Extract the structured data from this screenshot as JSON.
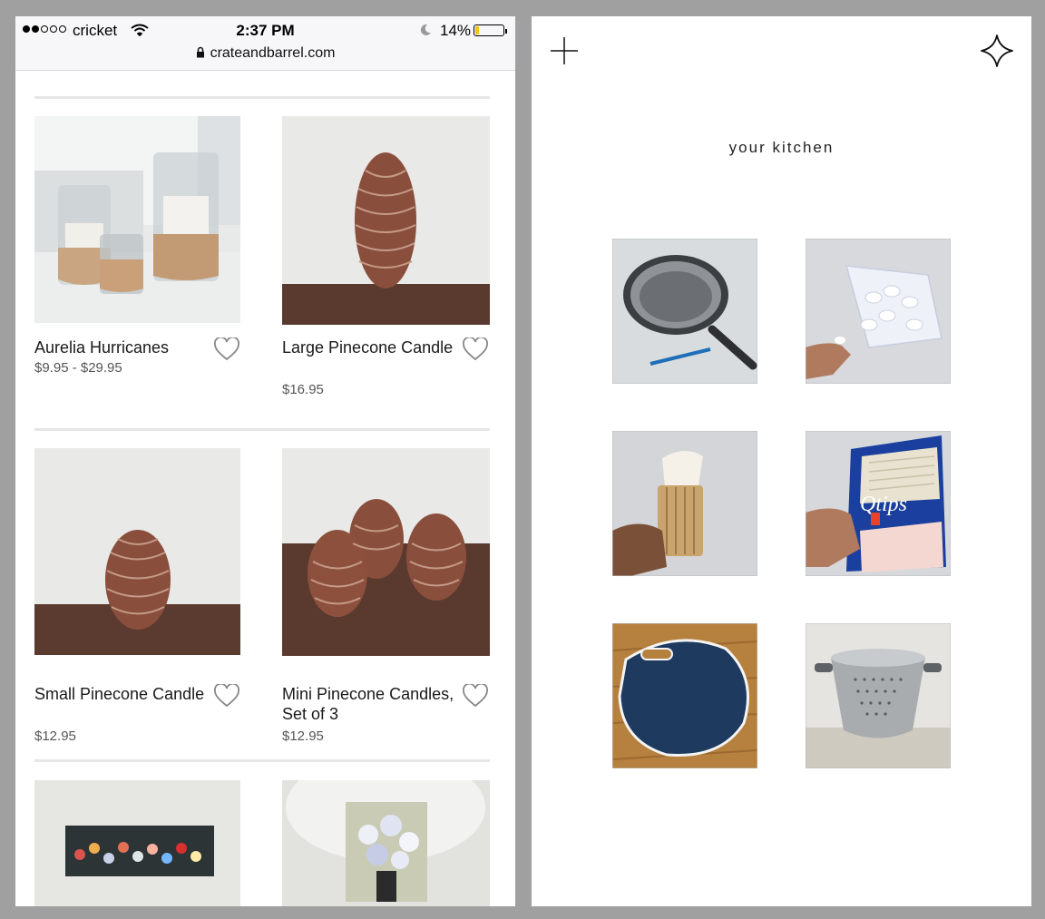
{
  "left_screen": {
    "status": {
      "carrier": "cricket",
      "time": "2:37 PM",
      "battery_percent": "14%",
      "battery_level": 0.14,
      "signal_bars": 2,
      "url": "crateandbarrel.com"
    },
    "products": [
      {
        "name": "Aurelia Hurricanes",
        "price": "$9.95 - $29.95",
        "icon": "heart-icon"
      },
      {
        "name": "Large Pinecone Candle",
        "price": "$16.95",
        "icon": "heart-icon"
      },
      {
        "name": "Small Pinecone Candle",
        "price": "$12.95",
        "icon": "heart-icon"
      },
      {
        "name": "Mini Pinecone Candles, Set of 3",
        "price": "$12.95",
        "icon": "heart-icon"
      }
    ]
  },
  "right_screen": {
    "title": "your kitchen",
    "icons": {
      "left": "plus-icon",
      "right": "sparkle-icon"
    },
    "items": [
      "frying-pan-photo",
      "plastic-spoons-photo",
      "pastry-brush-photo",
      "qtips-photo",
      "blue-bag-photo",
      "colander-photo"
    ],
    "qtips_label": "Qtips"
  },
  "colors": {
    "background": "#a0a0a0",
    "battery": "#f0c419",
    "divider": "#e6e6e6"
  }
}
